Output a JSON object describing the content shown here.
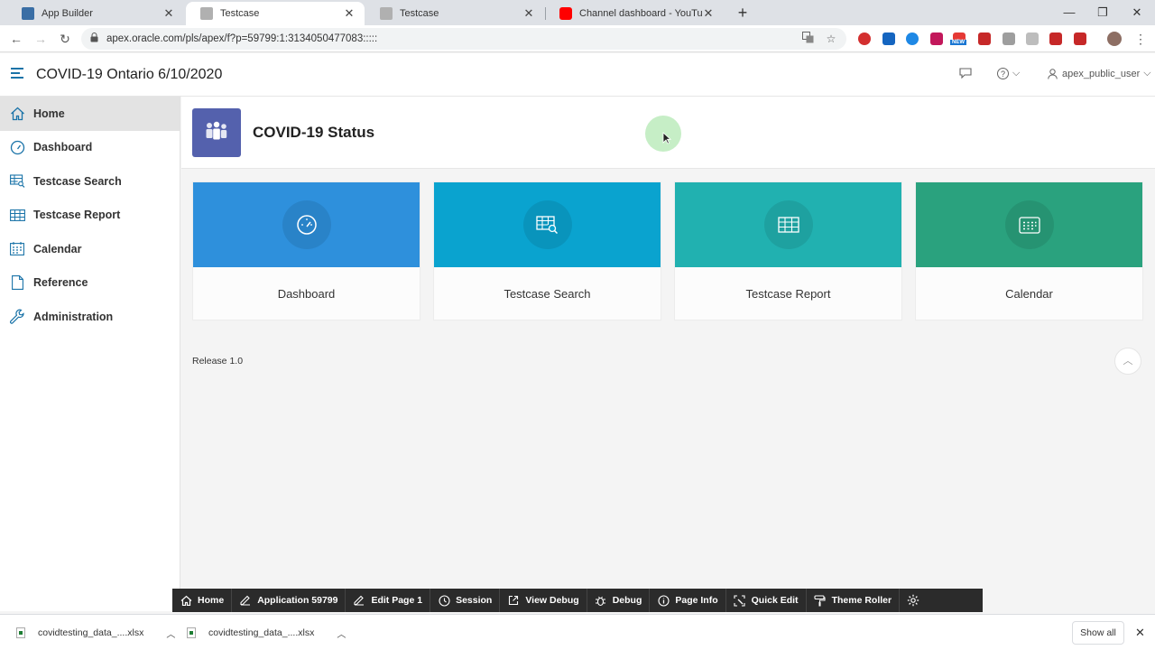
{
  "browser": {
    "tabs": [
      {
        "title": "App Builder",
        "active": false,
        "favicon_color": "#3a6ea5"
      },
      {
        "title": "Testcase",
        "active": true,
        "favicon_color": "#9e9e9e"
      },
      {
        "title": "Testcase",
        "active": false,
        "favicon_color": "#9e9e9e"
      },
      {
        "title": "Channel dashboard - YouTube St",
        "active": false,
        "favicon_color": "#ff0000"
      }
    ],
    "url": "apex.oracle.com/pls/apex/f?p=59799:1:3134050477083:::::",
    "new_tab_label": "+",
    "ext_badge": "NEW"
  },
  "header": {
    "app_title": "COVID-19 Ontario 6/10/2020",
    "help_label": "?",
    "user_label": "apex_public_user"
  },
  "sidebar": {
    "items": [
      {
        "label": "Home",
        "icon": "home-icon",
        "active": true
      },
      {
        "label": "Dashboard",
        "icon": "gauge-icon",
        "active": false
      },
      {
        "label": "Testcase Search",
        "icon": "search-table-icon",
        "active": false
      },
      {
        "label": "Testcase Report",
        "icon": "table-icon",
        "active": false
      },
      {
        "label": "Calendar",
        "icon": "calendar-icon",
        "active": false
      },
      {
        "label": "Reference",
        "icon": "document-icon",
        "active": false
      },
      {
        "label": "Administration",
        "icon": "wrench-icon",
        "active": false
      }
    ]
  },
  "hero": {
    "title": "COVID-19 Status",
    "icon": "people-icon",
    "icon_color": "#5461ad"
  },
  "cards": [
    {
      "label": "Dashboard",
      "color": "#2e90dc",
      "icon": "gauge-icon"
    },
    {
      "label": "Testcase Search",
      "color": "#0aa3cf",
      "icon": "search-table-icon"
    },
    {
      "label": "Testcase Report",
      "color": "#21b1b0",
      "icon": "table-icon"
    },
    {
      "label": "Calendar",
      "color": "#2aa27e",
      "icon": "calendar-icon"
    }
  ],
  "footer": {
    "release": "Release 1.0"
  },
  "devbar": {
    "items": [
      {
        "label": "Home",
        "icon": "home-icon"
      },
      {
        "label": "Application 59799",
        "icon": "edit-icon"
      },
      {
        "label": "Edit Page 1",
        "icon": "edit-icon"
      },
      {
        "label": "Session",
        "icon": "session-icon"
      },
      {
        "label": "View Debug",
        "icon": "external-icon"
      },
      {
        "label": "Debug",
        "icon": "bug-icon"
      },
      {
        "label": "Page Info",
        "icon": "info-icon"
      },
      {
        "label": "Quick Edit",
        "icon": "quick-edit-icon"
      },
      {
        "label": "Theme Roller",
        "icon": "paint-roller-icon"
      }
    ]
  },
  "downloads": {
    "items": [
      {
        "name": "covidtesting_data_....xlsx"
      },
      {
        "name": "covidtesting_data_....xlsx"
      }
    ],
    "show_all": "Show all"
  }
}
